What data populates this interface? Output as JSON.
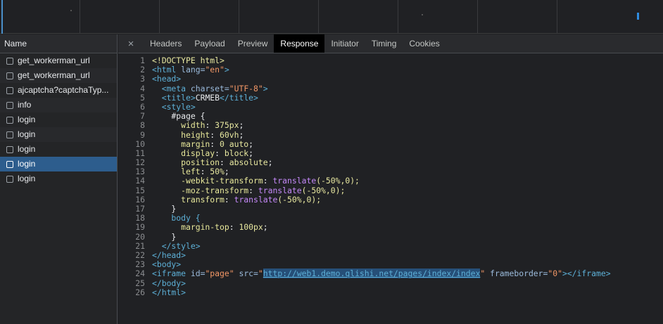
{
  "request_list": {
    "header": "Name",
    "items": [
      {
        "label": "get_workerman_url",
        "selected": false
      },
      {
        "label": "get_workerman_url",
        "selected": false
      },
      {
        "label": "ajcaptcha?captchaTyp...",
        "selected": false
      },
      {
        "label": "info",
        "selected": false
      },
      {
        "label": "login",
        "selected": false
      },
      {
        "label": "login",
        "selected": false
      },
      {
        "label": "login",
        "selected": false
      },
      {
        "label": "login",
        "selected": true
      },
      {
        "label": "login",
        "selected": false
      }
    ]
  },
  "tabs": {
    "close_icon": "×",
    "items": [
      {
        "label": "Headers",
        "active": false
      },
      {
        "label": "Payload",
        "active": false
      },
      {
        "label": "Preview",
        "active": false
      },
      {
        "label": "Response",
        "active": true
      },
      {
        "label": "Initiator",
        "active": false
      },
      {
        "label": "Timing",
        "active": false
      },
      {
        "label": "Cookies",
        "active": false
      }
    ]
  },
  "response": {
    "lines": [
      [
        {
          "t": "<!DOCTYPE html>",
          "c": "c-doc"
        }
      ],
      [
        {
          "t": "<html ",
          "c": "c-tag"
        },
        {
          "t": "lang=",
          "c": "c-attr"
        },
        {
          "t": "\"en\"",
          "c": "c-str"
        },
        {
          "t": ">",
          "c": "c-tag"
        }
      ],
      [
        {
          "t": "<head>",
          "c": "c-tag"
        }
      ],
      [
        {
          "t": "  <meta ",
          "c": "c-tag"
        },
        {
          "t": "charset=",
          "c": "c-attr"
        },
        {
          "t": "\"UTF-8\"",
          "c": "c-str"
        },
        {
          "t": ">",
          "c": "c-tag"
        }
      ],
      [
        {
          "t": "  <title>",
          "c": "c-tag"
        },
        {
          "t": "CRMEB",
          "c": "c-sel"
        },
        {
          "t": "</title>",
          "c": "c-tag"
        }
      ],
      [
        {
          "t": "  <style>",
          "c": "c-tag"
        }
      ],
      [
        {
          "t": "    #page {",
          "c": "c-sel"
        }
      ],
      [
        {
          "t": "      width",
          "c": "c-prop"
        },
        {
          "t": ": ",
          "c": "c-sel"
        },
        {
          "t": "375px",
          "c": "c-val"
        },
        {
          "t": ";",
          "c": "c-sel"
        }
      ],
      [
        {
          "t": "      height",
          "c": "c-prop"
        },
        {
          "t": ": ",
          "c": "c-sel"
        },
        {
          "t": "60vh",
          "c": "c-val"
        },
        {
          "t": ";",
          "c": "c-sel"
        }
      ],
      [
        {
          "t": "      margin",
          "c": "c-prop"
        },
        {
          "t": ": ",
          "c": "c-sel"
        },
        {
          "t": "0 auto",
          "c": "c-val"
        },
        {
          "t": ";",
          "c": "c-sel"
        }
      ],
      [
        {
          "t": "      display",
          "c": "c-prop"
        },
        {
          "t": ": ",
          "c": "c-sel"
        },
        {
          "t": "block",
          "c": "c-val"
        },
        {
          "t": ";",
          "c": "c-sel"
        }
      ],
      [
        {
          "t": "      position",
          "c": "c-prop"
        },
        {
          "t": ": ",
          "c": "c-sel"
        },
        {
          "t": "absolute",
          "c": "c-val"
        },
        {
          "t": ";",
          "c": "c-sel"
        }
      ],
      [
        {
          "t": "      left",
          "c": "c-prop"
        },
        {
          "t": ": ",
          "c": "c-sel"
        },
        {
          "t": "50%",
          "c": "c-val"
        },
        {
          "t": ";",
          "c": "c-sel"
        }
      ],
      [
        {
          "t": "      -webkit-transform",
          "c": "c-prop"
        },
        {
          "t": ": ",
          "c": "c-sel"
        },
        {
          "t": "translate",
          "c": "c-fn"
        },
        {
          "t": "(-50%,0);",
          "c": "c-val"
        }
      ],
      [
        {
          "t": "      -moz-transform",
          "c": "c-prop"
        },
        {
          "t": ": ",
          "c": "c-sel"
        },
        {
          "t": "translate",
          "c": "c-fn"
        },
        {
          "t": "(-50%,0);",
          "c": "c-val"
        }
      ],
      [
        {
          "t": "      transform",
          "c": "c-prop"
        },
        {
          "t": ": ",
          "c": "c-sel"
        },
        {
          "t": "translate",
          "c": "c-fn"
        },
        {
          "t": "(-50%,0);",
          "c": "c-val"
        }
      ],
      [
        {
          "t": "    }",
          "c": "c-sel"
        }
      ],
      [
        {
          "t": "    body {",
          "c": "c-tag"
        }
      ],
      [
        {
          "t": "      margin-top",
          "c": "c-prop"
        },
        {
          "t": ": ",
          "c": "c-sel"
        },
        {
          "t": "100px",
          "c": "c-val"
        },
        {
          "t": ";",
          "c": "c-sel"
        }
      ],
      [
        {
          "t": "    }",
          "c": "c-sel"
        }
      ],
      [
        {
          "t": "  </style>",
          "c": "c-tag"
        }
      ],
      [
        {
          "t": "</head>",
          "c": "c-tag"
        }
      ],
      [
        {
          "t": "<body>",
          "c": "c-tag"
        }
      ],
      [
        {
          "t": "<iframe ",
          "c": "c-tag"
        },
        {
          "t": "id=",
          "c": "c-attr"
        },
        {
          "t": "\"page\"",
          "c": "c-str"
        },
        {
          "t": " src=",
          "c": "c-attr"
        },
        {
          "t": "\"",
          "c": "c-str"
        },
        {
          "t": "http://web1.demo.qlishi.net/pages/index/index",
          "c": "c-link"
        },
        {
          "t": "\"",
          "c": "c-str"
        },
        {
          "t": " frameborder=",
          "c": "c-attr"
        },
        {
          "t": "\"0\"",
          "c": "c-str"
        },
        {
          "t": "></iframe>",
          "c": "c-tag"
        }
      ],
      [
        {
          "t": "</body>",
          "c": "c-tag"
        }
      ],
      [
        {
          "t": "</html>",
          "c": "c-tag"
        }
      ]
    ]
  }
}
